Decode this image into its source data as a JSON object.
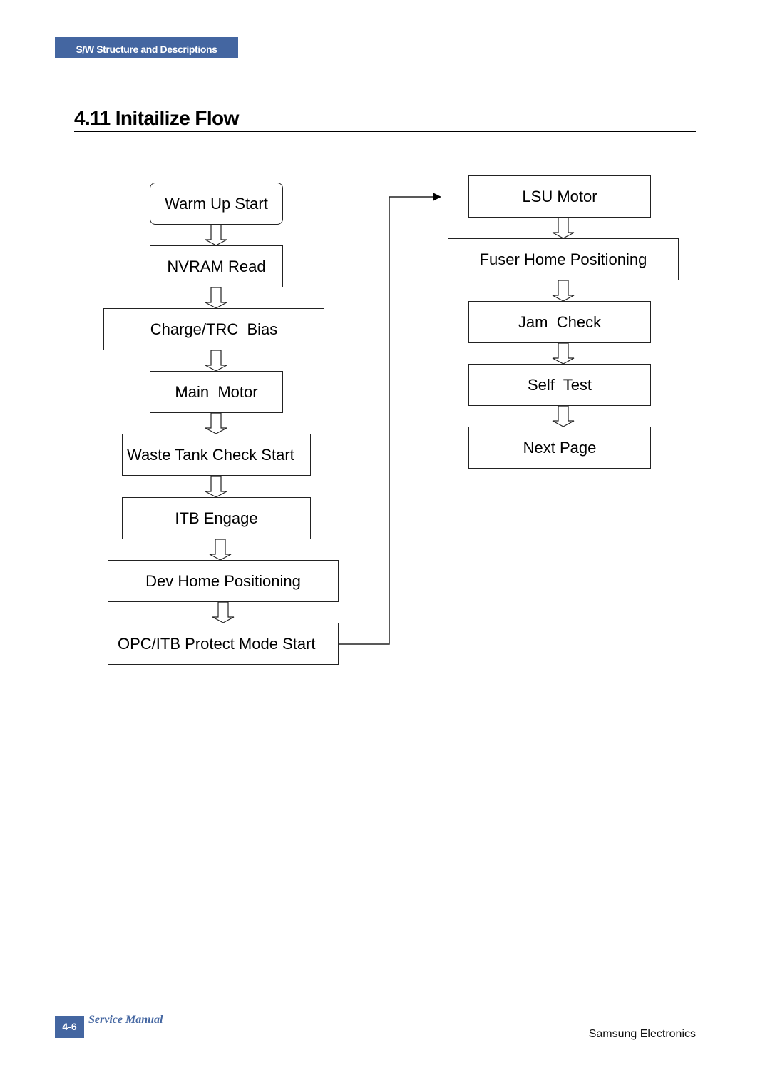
{
  "header": {
    "section_tab": "S/W Structure and Descriptions"
  },
  "page": {
    "title": "4.11 Initailize Flow"
  },
  "flow": {
    "left_column": [
      {
        "label": "Warm Up Start",
        "shape": "rounded"
      },
      {
        "label": "NVRAM Read",
        "shape": "rect"
      },
      {
        "label": "Charge/TRC  Bias",
        "shape": "rect"
      },
      {
        "label": "Main  Motor",
        "shape": "rect"
      },
      {
        "label": "Waste Tank Check Start",
        "shape": "rect"
      },
      {
        "label": "ITB Engage",
        "shape": "rect"
      },
      {
        "label": "Dev Home Positioning",
        "shape": "rect"
      },
      {
        "label": "OPC/ITB Protect Mode Start",
        "shape": "rect"
      }
    ],
    "right_column": [
      {
        "label": "LSU Motor",
        "shape": "rect"
      },
      {
        "label": "Fuser Home Positioning",
        "shape": "rect"
      },
      {
        "label": "Jam  Check",
        "shape": "rect"
      },
      {
        "label": "Self  Test",
        "shape": "rect"
      },
      {
        "label": "Next Page",
        "shape": "rect"
      }
    ],
    "connections": [
      {
        "from": "Warm Up Start",
        "to": "NVRAM Read",
        "style": "hollow-arrow"
      },
      {
        "from": "NVRAM Read",
        "to": "Charge/TRC  Bias",
        "style": "hollow-arrow"
      },
      {
        "from": "Charge/TRC  Bias",
        "to": "Main  Motor",
        "style": "hollow-arrow"
      },
      {
        "from": "Main  Motor",
        "to": "Waste Tank Check Start",
        "style": "hollow-arrow"
      },
      {
        "from": "Waste Tank Check Start",
        "to": "ITB Engage",
        "style": "hollow-arrow"
      },
      {
        "from": "ITB Engage",
        "to": "Dev Home Positioning",
        "style": "hollow-arrow"
      },
      {
        "from": "Dev Home Positioning",
        "to": "OPC/ITB Protect Mode Start",
        "style": "hollow-arrow"
      },
      {
        "from": "OPC/ITB Protect Mode Start",
        "to": "LSU Motor",
        "style": "line-arrow"
      },
      {
        "from": "LSU Motor",
        "to": "Fuser Home Positioning",
        "style": "hollow-arrow"
      },
      {
        "from": "Fuser Home Positioning",
        "to": "Jam  Check",
        "style": "hollow-arrow"
      },
      {
        "from": "Jam  Check",
        "to": "Self  Test",
        "style": "hollow-arrow"
      },
      {
        "from": "Self  Test",
        "to": "Next Page",
        "style": "hollow-arrow"
      }
    ]
  },
  "footer": {
    "page_number": "4-6",
    "manual_label": "Service Manual",
    "company": "Samsung Electronics"
  },
  "colors": {
    "brand_blue": "#4466a1",
    "rule_blue": "#7f95bf"
  }
}
